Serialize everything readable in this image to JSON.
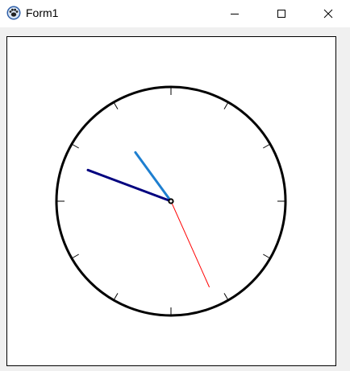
{
  "window": {
    "title": "Form1",
    "icon": "paw-app-icon",
    "controls": {
      "minimize": "minimize-icon",
      "maximize": "maximize-icon",
      "close": "close-icon"
    }
  },
  "clock": {
    "hour": 10,
    "minute": 48,
    "second": 26,
    "tick_count": 12,
    "colors": {
      "face": "#000000",
      "hour_hand": "#1e7fd0",
      "minute_hand": "#00007f",
      "second_hand": "#ff0000",
      "background": "#ffffff"
    }
  }
}
